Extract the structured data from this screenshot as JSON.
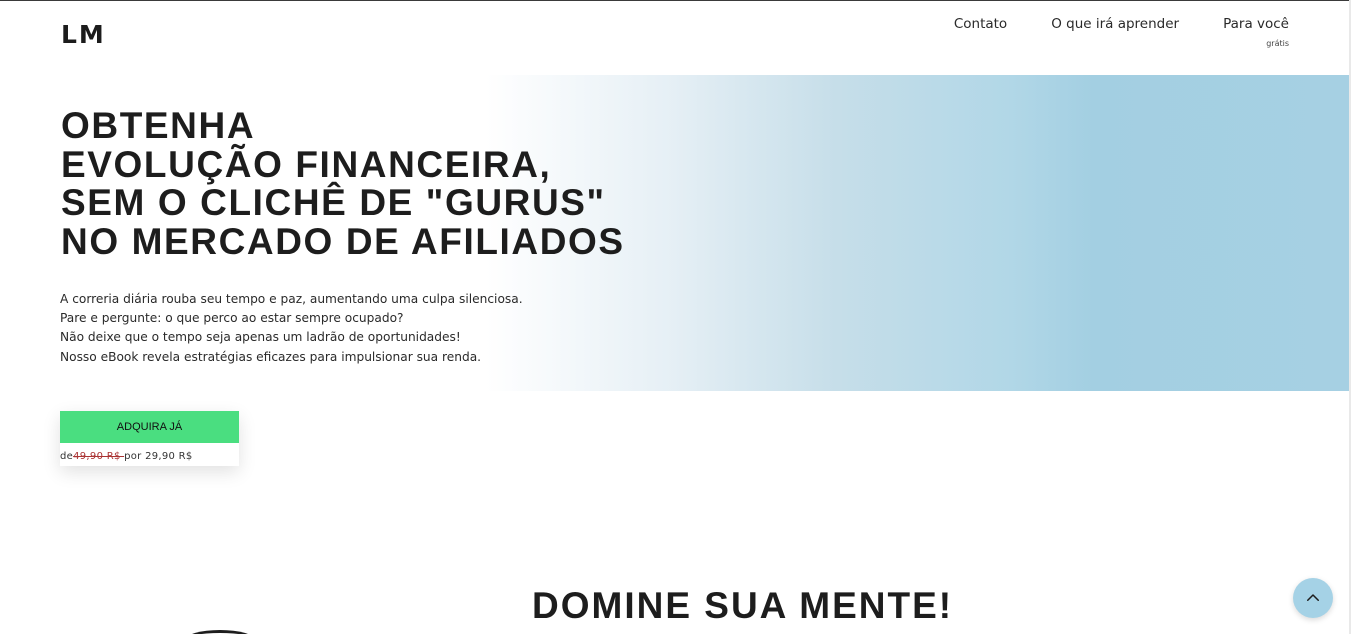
{
  "header": {
    "logo": "LM",
    "nav": [
      {
        "label": "Contato"
      },
      {
        "label": "O que irá aprender"
      },
      {
        "label": "Para você",
        "sub": "grátis"
      }
    ]
  },
  "hero": {
    "title_lines": [
      "OBTENHA",
      "EVOLUÇÃO FINANCEIRA,",
      "SEM O CLICHÊ DE \"GURUS\"",
      "NO MERCADO DE AFILIADOS"
    ],
    "paragraphs": [
      "A correria diária rouba seu tempo e paz, aumentando uma culpa silenciosa.",
      "Pare e pergunte: o que perco ao estar sempre ocupado?",
      "Não deixe que o tempo seja apenas um ladrão de oportunidades!",
      "Nosso eBook revela estratégias eficazes para impulsionar sua renda."
    ],
    "cta_label": "ADQUIRA JÁ",
    "price": {
      "prefix": "de",
      "old": "49,90 R$ ",
      "middle": "por 29,90 R$"
    }
  },
  "section": {
    "title": "DOMINE SUA MENTE!"
  },
  "icons": {
    "scroll_top": "chevron-up-icon"
  },
  "colors": {
    "accent_green": "#4ade80",
    "band_blue": "#a6d0e3"
  }
}
